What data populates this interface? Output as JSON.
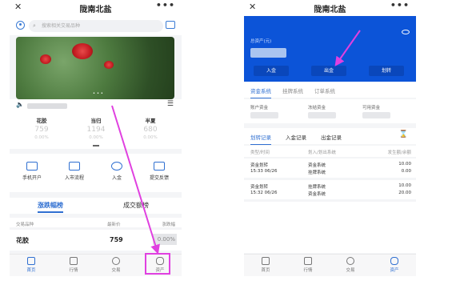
{
  "left_phone": {
    "title": "陇南北盐",
    "search_placeholder": "搜索相关交易品种",
    "tickers": [
      {
        "name": "花胶",
        "price": "759",
        "change": "0.00%"
      },
      {
        "name": "当归",
        "price": "1194",
        "change": "0.00%"
      },
      {
        "name": "半夏",
        "price": "680",
        "change": "0.00%"
      }
    ],
    "quick_actions": [
      "手机开户",
      "入市流程",
      "入金",
      "提交反馈"
    ],
    "market_tabs": [
      "涨跌幅榜",
      "成交额榜"
    ],
    "table_header": {
      "name": "交易品种",
      "price": "最新价",
      "change": "涨跌幅"
    },
    "rows": [
      {
        "name": "花胶",
        "price": "759",
        "change": "0.00%"
      }
    ],
    "tabbar": [
      "首页",
      "行情",
      "交易",
      "资产"
    ]
  },
  "right_phone": {
    "title": "陇南北盐",
    "asset_label": "总资产(元)",
    "buttons": [
      "入金",
      "出金",
      "划转"
    ],
    "system_tabs": [
      "资金系统",
      "挂牌系统",
      "订单系统"
    ],
    "balance_labels": [
      "账户资金",
      "冻结资金",
      "可用资金"
    ],
    "record_tabs": [
      "划转记录",
      "入金记录",
      "出金记录"
    ],
    "record_header": {
      "type": "类型/时间",
      "direction": "划入/划出系统",
      "amount": "发生额/余额"
    },
    "records": [
      {
        "type": "资金划转",
        "time": "15:33 06/26",
        "in": "资金系统",
        "out": "挂牌系统",
        "amount": "10.00",
        "balance": "0.00"
      },
      {
        "type": "资金划转",
        "time": "15:32 06/26",
        "in": "挂牌系统",
        "out": "资金系统",
        "amount": "10.00",
        "balance": "20.00"
      }
    ],
    "tabbar": [
      "首页",
      "行情",
      "交易",
      "资产"
    ]
  },
  "colors": {
    "accent": "#2f6fd1",
    "header_blue": "#0c54d8",
    "highlight": "#e040e0"
  },
  "icons": [
    "close-icon",
    "more-icon",
    "user-icon",
    "chat-icon",
    "search-icon",
    "speaker-icon",
    "menu-icon",
    "eye-icon",
    "hourglass-icon",
    "home-icon",
    "market-icon",
    "trade-icon",
    "asset-icon"
  ]
}
